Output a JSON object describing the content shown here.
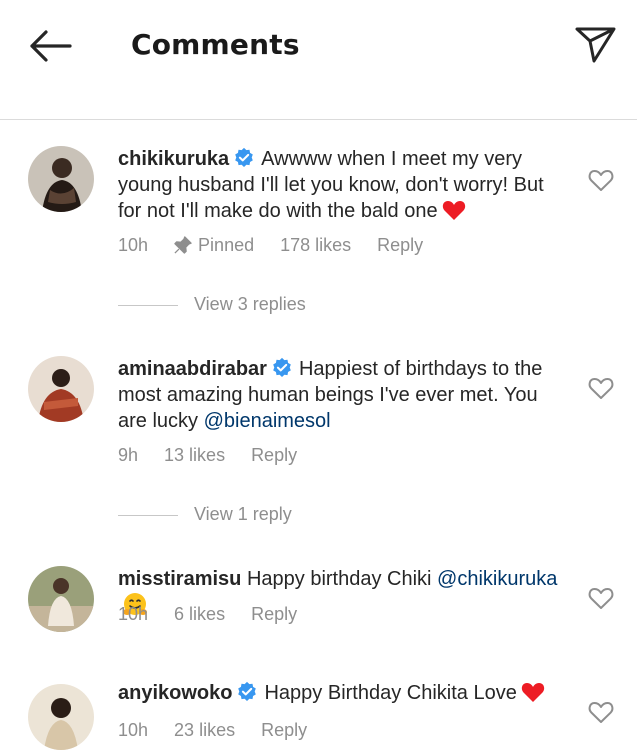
{
  "header": {
    "title": "Comments",
    "back_icon": "arrow-left-icon",
    "share_icon": "paper-plane-icon"
  },
  "comments": [
    {
      "username": "chikikuruka",
      "verified": true,
      "text": "Awwww when I meet my very young husband I'll let you know, don't worry! But for not I'll make do with the bald one",
      "emoji": "red-heart",
      "time": "10h",
      "pinned": "Pinned",
      "likes": "178 likes",
      "reply": "Reply",
      "view_replies": "View 3 replies"
    },
    {
      "username": "aminaabdirabar",
      "verified": true,
      "text": "Happiest of birthdays to the most amazing human beings I've ever met. You are lucky",
      "mention": "@bienaimesol",
      "time": "9h",
      "likes": "13 likes",
      "reply": "Reply",
      "view_replies": "View 1 reply"
    },
    {
      "username": "misstiramisu",
      "verified": false,
      "text": "Happy birthday Chiki",
      "mention": "@chikikuruka",
      "emoji": "hugging-face",
      "time": "10h",
      "likes": "6 likes",
      "reply": "Reply"
    },
    {
      "username": "anyikowoko",
      "verified": true,
      "text": "Happy Birthday Chikita Love",
      "emoji": "red-heart",
      "time": "10h",
      "likes": "23 likes",
      "reply": "Reply"
    }
  ],
  "colors": {
    "verified_blue": "#3897f0",
    "mention": "#00376b",
    "meta_gray": "#8e8e8e",
    "heart_red": "#ed1c24"
  }
}
